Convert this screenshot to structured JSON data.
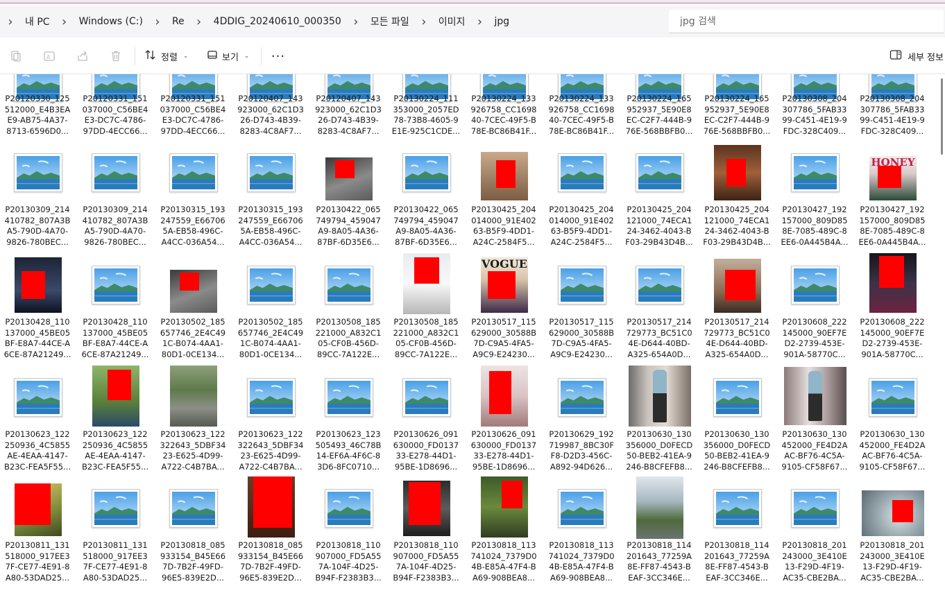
{
  "address_bar": {
    "breadcrumbs": [
      "내 PC",
      "Windows (C:)",
      "Re",
      "4DDIG_20240610_000350",
      "모든 파일",
      "이미지",
      "jpg"
    ]
  },
  "search": {
    "placeholder": "jpg 검색"
  },
  "toolbar": {
    "sort_label": "정렬",
    "view_label": "보기",
    "more_label": "···",
    "details_label": "세부 정보"
  },
  "rows": [
    {
      "items": [
        {
          "line1": "P20120330_125",
          "line2": "512000_E4B3EA",
          "line3": "E9-AB75-4A37-",
          "line4": "8713-6596D0...",
          "thumb": "default"
        },
        {
          "line1": "P20120331_151",
          "line2": "037000_C56BE4",
          "line3": "E3-DC7C-4786-",
          "line4": "97DD-4ECC66...",
          "thumb": "default"
        },
        {
          "line1": "P20120331_151",
          "line2": "037000_C56BE4",
          "line3": "E3-DC7C-4786-",
          "line4": "97DD-4ECC66...",
          "thumb": "default"
        },
        {
          "line1": "P20120407_143",
          "line2": "923000_62C1D3",
          "line3": "26-D743-4B39-",
          "line4": "8283-4C8AF7...",
          "thumb": "default"
        },
        {
          "line1": "P20120407_143",
          "line2": "923000_62C1D3",
          "line3": "26-D743-4B39-",
          "line4": "8283-4C8AF7...",
          "thumb": "default"
        },
        {
          "line1": "P20130224_111",
          "line2": "353000_2057ED",
          "line3": "78-73B8-4605-9",
          "line4": "E1E-925C1CDE...",
          "thumb": "default"
        },
        {
          "line1": "P20130224_133",
          "line2": "926758_CC1698",
          "line3": "40-7CEC-49F5-B",
          "line4": "78E-BC86B41F...",
          "thumb": "default"
        },
        {
          "line1": "P20130224_133",
          "line2": "926758_CC1698",
          "line3": "40-7CEC-49F5-B",
          "line4": "78E-BC86B41F...",
          "thumb": "default"
        },
        {
          "line1": "P20130224_165",
          "line2": "952937_5E90E8",
          "line3": "EC-C2F7-444B-9",
          "line4": "76E-568BBFB0...",
          "thumb": "default"
        },
        {
          "line1": "P20130224_165",
          "line2": "952937_5E90E8",
          "line3": "EC-C2F7-444B-9",
          "line4": "76E-568BBFB0...",
          "thumb": "default"
        },
        {
          "line1": "P20130308_204",
          "line2": "307786_5FAB33",
          "line3": "99-C451-4E19-9",
          "line4": "FDC-328C409...",
          "thumb": "default"
        },
        {
          "line1": "P20130308_204",
          "line2": "307786_5FAB33",
          "line3": "99-C451-4E19-9",
          "line4": "FDC-328C409...",
          "thumb": "default"
        }
      ]
    },
    {
      "items": [
        {
          "line1": "P20130309_214",
          "line2": "410782_807A3B",
          "line3": "A5-790D-4A70-",
          "line4": "9826-780BEC...",
          "thumb": "default"
        },
        {
          "line1": "P20130309_214",
          "line2": "410782_807A3B",
          "line3": "A5-790D-4A70-",
          "line4": "9826-780BEC...",
          "thumb": "default"
        },
        {
          "line1": "P20130315_193",
          "line2": "247559_E66706",
          "line3": "5A-EB58-496C-",
          "line4": "A4CC-036A54...",
          "thumb": "default"
        },
        {
          "line1": "P20130315_193",
          "line2": "247559_E66706",
          "line3": "5A-EB58-496C-",
          "line4": "A4CC-036A54...",
          "thumb": "default"
        },
        {
          "line1": "P20130422_065",
          "line2": "749794_459047",
          "line3": "A9-8A05-4A36-",
          "line4": "87BF-6D35E6...",
          "thumb": "photo-gray"
        },
        {
          "line1": "P20130422_065",
          "line2": "749794_459047",
          "line3": "A9-8A05-4A36-",
          "line4": "87BF-6D35E6...",
          "thumb": "default"
        },
        {
          "line1": "P20130425_204",
          "line2": "014000_91E402",
          "line3": "63-B5F9-4DD1-",
          "line4": "A24C-2584F5...",
          "thumb": "photo-tan"
        },
        {
          "line1": "P20130425_204",
          "line2": "014000_91E402",
          "line3": "63-B5F9-4DD1-",
          "line4": "A24C-2584F5...",
          "thumb": "default"
        },
        {
          "line1": "P20130425_204",
          "line2": "121000_74ECA1",
          "line3": "24-3462-4043-B",
          "line4": "F03-29B43D4B...",
          "thumb": "default"
        },
        {
          "line1": "P20130425_204",
          "line2": "121000_74ECA1",
          "line3": "24-3462-4043-B",
          "line4": "F03-29B43D4B...",
          "thumb": "photo-wood"
        },
        {
          "line1": "P20130427_192",
          "line2": "157000_809D85",
          "line3": "8E-7085-489C-8",
          "line4": "EE6-0A445B4A...",
          "thumb": "default"
        },
        {
          "line1": "P20130427_192",
          "line2": "157000_809D85",
          "line3": "8E-7085-489C-8",
          "line4": "EE6-0A445B4A...",
          "thumb": "photo-honey"
        }
      ]
    },
    {
      "items": [
        {
          "line1": "P20130428_110",
          "line2": "137000_45BE05",
          "line3": "BF-E8A7-44CE-A",
          "line4": "6CE-87A21249...",
          "thumb": "photo-dark"
        },
        {
          "line1": "P20130428_110",
          "line2": "137000_45BE05",
          "line3": "BF-E8A7-44CE-A",
          "line4": "6CE-87A21249...",
          "thumb": "default"
        },
        {
          "line1": "P20130502_185",
          "line2": "657746_2E4C49",
          "line3": "1C-B074-4AA1-",
          "line4": "80D1-0CE134...",
          "thumb": "photo-gray"
        },
        {
          "line1": "P20130502_185",
          "line2": "657746_2E4C49",
          "line3": "1C-B074-4AA1-",
          "line4": "80D1-0CE134...",
          "thumb": "default"
        },
        {
          "line1": "P20130508_185",
          "line2": "221000_A832C1",
          "line3": "05-CF0B-456D-",
          "line4": "89CC-7A122E...",
          "thumb": "default"
        },
        {
          "line1": "P20130508_185",
          "line2": "221000_A832C1",
          "line3": "05-CF0B-456D-",
          "line4": "89CC-7A122E...",
          "thumb": "photo-light"
        },
        {
          "line1": "P20130517_115",
          "line2": "629000_30588B",
          "line3": "7D-C9A5-4FA5-",
          "line4": "A9C9-E24230...",
          "thumb": "photo-vogue"
        },
        {
          "line1": "P20130517_115",
          "line2": "629000_30588B",
          "line3": "7D-C9A5-4FA5-",
          "line4": "A9C9-E24230...",
          "thumb": "default"
        },
        {
          "line1": "P20130517_214",
          "line2": "729773_BC51C0",
          "line3": "4E-D644-40BD-",
          "line4": "A325-654A0D...",
          "thumb": "default"
        },
        {
          "line1": "P20130517_214",
          "line2": "729773_BC51C0",
          "line3": "4E-D644-40BD-",
          "line4": "A325-654A0D...",
          "thumb": "photo-tan2"
        },
        {
          "line1": "P20130608_222",
          "line2": "145000_90EF7E",
          "line3": "D2-2739-453E-",
          "line4": "901A-58770C...",
          "thumb": "default"
        },
        {
          "line1": "P20130608_222",
          "line2": "145000_90EF7E",
          "line3": "D2-2739-453E-",
          "line4": "901A-58770C...",
          "thumb": "photo-night"
        }
      ]
    },
    {
      "items": [
        {
          "line1": "P20130623_122",
          "line2": "250936_4C5855",
          "line3": "AE-4EAA-4147-",
          "line4": "B23C-FEA5F55...",
          "thumb": "default"
        },
        {
          "line1": "P20130623_122",
          "line2": "250936_4C5855",
          "line3": "AE-4EAA-4147-",
          "line4": "B23C-FEA5F55...",
          "thumb": "photo-green"
        },
        {
          "line1": "P20130623_122",
          "line2": "322643_5DBF34",
          "line3": "23-E625-4D99-",
          "line4": "A722-C4B7BA...",
          "thumb": "photo-river"
        },
        {
          "line1": "P20130623_122",
          "line2": "322643_5DBF34",
          "line3": "23-E625-4D99-",
          "line4": "A722-C4B7BA...",
          "thumb": "default"
        },
        {
          "line1": "P20130623_123",
          "line2": "505493_46C78B",
          "line3": "14-EF6A-4F6C-8",
          "line4": "3D6-8FC0710...",
          "thumb": "default"
        },
        {
          "line1": "P20130626_091",
          "line2": "630000_FD0137",
          "line3": "33-E278-44D1-",
          "line4": "95BE-1D8696...",
          "thumb": "default"
        },
        {
          "line1": "P20130626_091",
          "line2": "630000_FD0137",
          "line3": "33-E278-44D1-",
          "line4": "95BE-1D8696...",
          "thumb": "photo-room"
        },
        {
          "line1": "P20130629_192",
          "line2": "719987_8BC30F",
          "line3": "F8-D2D3-456C-",
          "line4": "A892-94D626...",
          "thumb": "default"
        },
        {
          "line1": "P20130630_130",
          "line2": "356000_D0FECD",
          "line3": "50-BEB2-41EA-9",
          "line4": "246-B8CFEFB8...",
          "thumb": "photo-mall"
        },
        {
          "line1": "P20130630_130",
          "line2": "356000_D0FECD",
          "line3": "50-BEB2-41EA-9",
          "line4": "246-B8CFEFB8...",
          "thumb": "default"
        },
        {
          "line1": "P20130630_130",
          "line2": "452000_FE4D2A",
          "line3": "AC-BF76-4C5A-",
          "line4": "9105-CF58F67...",
          "thumb": "photo-mall2"
        },
        {
          "line1": "P20130630_130",
          "line2": "452000_FE4D2A",
          "line3": "AC-BF76-4C5A-",
          "line4": "9105-CF58F67...",
          "thumb": "default"
        }
      ]
    },
    {
      "items": [
        {
          "line1": "P20130811_131",
          "line2": "518000_917EE3",
          "line3": "7F-CE77-4E91-8",
          "line4": "A80-53DAD25...",
          "thumb": "photo-yellow"
        },
        {
          "line1": "P20130811_131",
          "line2": "518000_917EE3",
          "line3": "7F-CE77-4E91-8",
          "line4": "A80-53DAD25...",
          "thumb": "default"
        },
        {
          "line1": "P20130818_085",
          "line2": "933154_B45E66",
          "line3": "7D-7B2F-49FD-",
          "line4": "96E5-839E2D...",
          "thumb": "default"
        },
        {
          "line1": "P20130818_085",
          "line2": "933154_B45E66",
          "line3": "7D-7B2F-49FD-",
          "line4": "96E5-839E2D...",
          "thumb": "photo-brown"
        },
        {
          "line1": "P20130818_110",
          "line2": "907000_FD5A55",
          "line3": "7A-104F-4D25-",
          "line4": "B94F-F2383B3...",
          "thumb": "default"
        },
        {
          "line1": "P20130818_110",
          "line2": "907000_FD5A55",
          "line3": "7A-104F-4D25-",
          "line4": "B94F-F2383B3...",
          "thumb": "photo-dark2"
        },
        {
          "line1": "P20130818_113",
          "line2": "741024_7379D0",
          "line3": "4B-E85A-47F4-B",
          "line4": "A69-908BEA8...",
          "thumb": "photo-forest"
        },
        {
          "line1": "P20130818_113",
          "line2": "741024_7379D0",
          "line3": "4B-E85A-47F4-B",
          "line4": "A69-908BEA8...",
          "thumb": "default"
        },
        {
          "line1": "P20130818_114",
          "line2": "201643_77259A",
          "line3": "8E-FF87-4543-B",
          "line4": "EAF-3CC346E...",
          "thumb": "photo-park"
        },
        {
          "line1": "P20130818_114",
          "line2": "201643_77259A",
          "line3": "8E-FF87-4543-B",
          "line4": "EAF-3CC346E...",
          "thumb": "default"
        },
        {
          "line1": "P20130818_201",
          "line2": "243000_3E410E",
          "line3": "13-F29D-4F19-",
          "line4": "AC35-CBE2BA...",
          "thumb": "default"
        },
        {
          "line1": "P20130818_201",
          "line2": "243000_3E410E",
          "line3": "13-F29D-4F19-",
          "line4": "AC35-CBE2BA...",
          "thumb": "photo-water"
        }
      ]
    }
  ],
  "photo_texts": {
    "honey": "HONEY",
    "vogue": "VOGUE"
  },
  "colors": {
    "redaction": "#ff0000",
    "sky": "#6fb3e8",
    "sea": "#2a7bbd",
    "hills": "#3d8a6a"
  }
}
